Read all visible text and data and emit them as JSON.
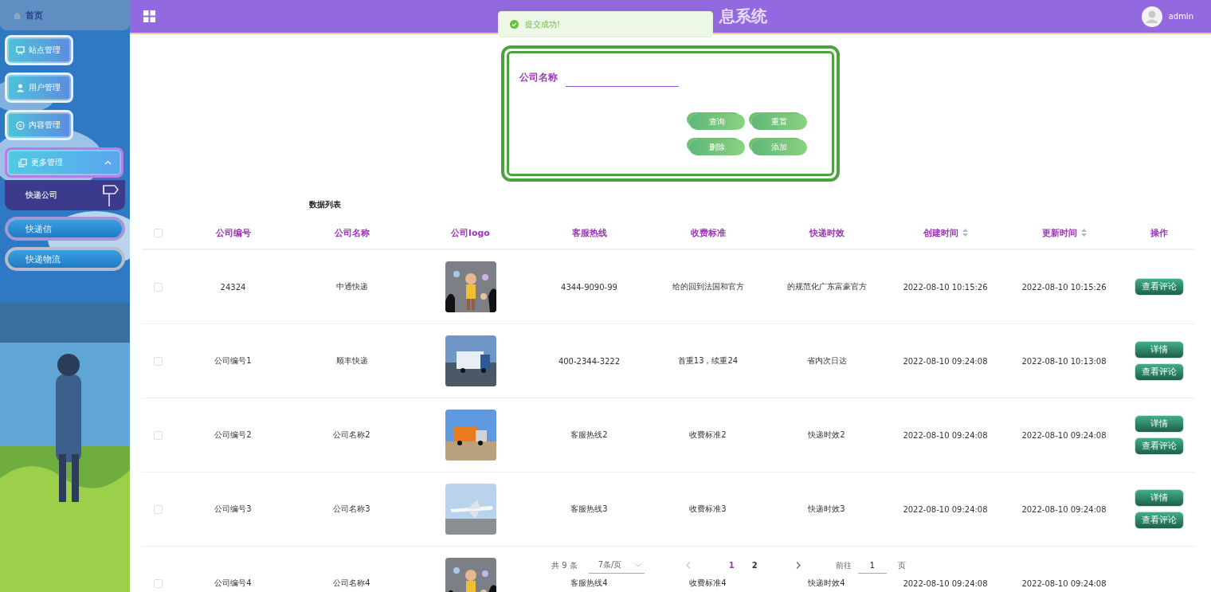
{
  "sidebar": {
    "home": "首页",
    "items": [
      {
        "label": "站点管理",
        "kind": "link",
        "selected": false
      },
      {
        "label": "用户管理",
        "kind": "link",
        "selected": false
      },
      {
        "label": "内容管理",
        "kind": "link",
        "selected": false
      },
      {
        "label": "更多管理",
        "kind": "group",
        "selected": true,
        "expanded": true
      }
    ],
    "submenu": {
      "title": "快递公司",
      "items": [
        {
          "label": "快递信",
          "selected": true
        },
        {
          "label": "快递物流",
          "selected": false
        }
      ]
    }
  },
  "header": {
    "title": "息系统",
    "user": "admin"
  },
  "toast": {
    "kind": "success",
    "text": "提交成功!"
  },
  "search": {
    "label": "公司名称",
    "buttons": [
      "查询",
      "重置",
      "删除",
      "添加"
    ]
  },
  "table": {
    "title": "数据列表",
    "select_all": {
      "checked": false
    },
    "columns": [
      {
        "label": "公司编号",
        "kind": "plain"
      },
      {
        "label": "公司名称",
        "kind": "plain"
      },
      {
        "label": "公司logo",
        "kind": "plain"
      },
      {
        "label": "客服热线",
        "kind": "plain"
      },
      {
        "label": "收费标准",
        "kind": "plain"
      },
      {
        "label": "快递时效",
        "kind": "plain"
      },
      {
        "label": "创建时间",
        "kind": "sortable"
      },
      {
        "label": "更新时间",
        "kind": "sortable"
      },
      {
        "label": "操作",
        "kind": "plain"
      }
    ],
    "rows": [
      {
        "checked": false,
        "code": "24324",
        "name": "中通快递",
        "logo": {
          "kind": "picture"
        },
        "hotline": "4344-9090-99",
        "fee": "给的回到法国和官方",
        "timeliness": "的规范化广东富豪官方",
        "created": "2022-08-10 10:15:26",
        "updated": "2022-08-10 10:15:26",
        "actions": [
          "查看评论"
        ]
      },
      {
        "checked": false,
        "code": "公司编号1",
        "name": "顺丰快递",
        "logo": {
          "kind": "picture"
        },
        "hotline": "400-2344-3222",
        "fee": "首重13，续重24",
        "timeliness": "省内次日达",
        "created": "2022-08-10 09:24:08",
        "updated": "2022-08-10 10:13:08",
        "actions": [
          "详情",
          "查看评论"
        ]
      },
      {
        "checked": false,
        "code": "公司编号2",
        "name": "公司名称2",
        "logo": {
          "kind": "picture"
        },
        "hotline": "客服热线2",
        "fee": "收费标准2",
        "timeliness": "快递时效2",
        "created": "2022-08-10 09:24:08",
        "updated": "2022-08-10 09:24:08",
        "actions": [
          "详情",
          "查看评论"
        ]
      },
      {
        "checked": false,
        "code": "公司编号3",
        "name": "公司名称3",
        "logo": {
          "kind": "picture"
        },
        "hotline": "客服热线3",
        "fee": "收费标准3",
        "timeliness": "快递时效3",
        "created": "2022-08-10 09:24:08",
        "updated": "2022-08-10 09:24:08",
        "actions": [
          "详情",
          "查看评论"
        ]
      },
      {
        "checked": false,
        "code": "公司编号4",
        "name": "公司名称4",
        "logo": {
          "kind": "picture"
        },
        "hotline": "客服热线4",
        "fee": "收费标准4",
        "timeliness": "快递时效4",
        "created": "2022-08-10 09:24:08",
        "updated": "2022-08-10 09:24:08",
        "actions": []
      }
    ]
  },
  "pagination": {
    "total": "共 9 条",
    "page_size": "7条/页",
    "pages": [
      {
        "label": "1",
        "selected": true
      },
      {
        "label": "2",
        "selected": false
      }
    ],
    "jump_label": "前往",
    "jump_value": "1",
    "jump_suffix": "页"
  }
}
